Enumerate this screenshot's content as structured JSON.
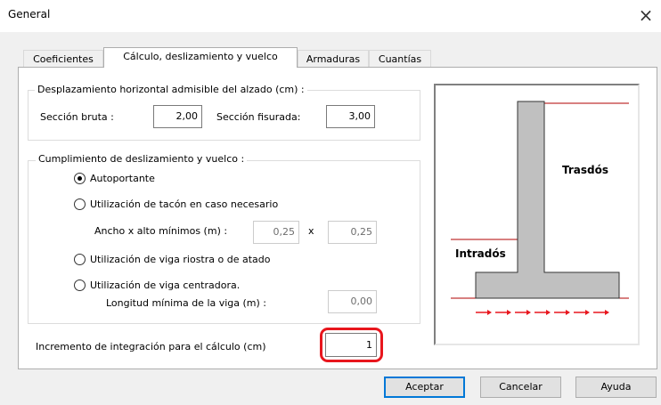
{
  "window": {
    "title": "General",
    "close_glyph": "×"
  },
  "tabs": [
    {
      "label": "Coeficientes",
      "active": false
    },
    {
      "label": "Cálculo, deslizamiento y vuelco",
      "active": true
    },
    {
      "label": "Armaduras",
      "active": false
    },
    {
      "label": "Cuantías",
      "active": false
    }
  ],
  "displacement": {
    "legend": "Desplazamiento horizontal admisible del alzado (cm) :",
    "bruta_label": "Sección bruta :",
    "bruta_value": "2,00",
    "fisurada_label": "Sección fisurada:",
    "fisurada_value": "3,00"
  },
  "sliding": {
    "legend": "Cumplimiento de deslizamiento y vuelco :",
    "options": [
      {
        "label": "Autoportante",
        "checked": true
      },
      {
        "label": "Utilización de tacón en caso necesario",
        "checked": false
      },
      {
        "label": "Utilización de viga riostra o de atado",
        "checked": false
      },
      {
        "label": "Utilización de viga centradora.",
        "checked": false
      }
    ],
    "dims_label": "Ancho x alto mínimos (m) :",
    "ancho_value": "0,25",
    "x_sep": "x",
    "alto_value": "0,25",
    "longitud_label": "Longitud mínima de la viga (m) :",
    "longitud_value": "0,00"
  },
  "increment": {
    "label": "Incremento de integración para el cálculo (cm)",
    "value": "1",
    "highlight_color": "#e8161d"
  },
  "diagram": {
    "trasdos_label": "Trasdós",
    "intrados_label": "Intradós",
    "arrow_color": "#e8161d",
    "line_color": "#b00000"
  },
  "buttons": {
    "accept": "Aceptar",
    "cancel": "Cancelar",
    "help": "Ayuda"
  }
}
